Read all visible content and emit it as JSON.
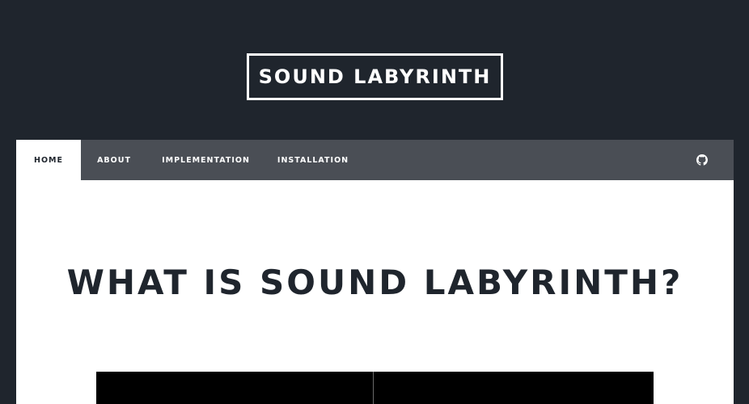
{
  "header": {
    "logo_text": "SOUND LABYRINTH"
  },
  "nav": {
    "items": [
      {
        "label": "HOME",
        "active": true
      },
      {
        "label": "ABOUT",
        "active": false
      },
      {
        "label": "IMPLEMENTATION",
        "active": false
      },
      {
        "label": "INSTALLATION",
        "active": false
      }
    ],
    "github_icon": "github-icon"
  },
  "main": {
    "title": "WHAT IS SOUND LABYRINTH?"
  },
  "colors": {
    "background_dark": "#1f252d",
    "navbar": "#4a4e55",
    "content_bg": "#ffffff",
    "text_dark": "#1f252d"
  }
}
